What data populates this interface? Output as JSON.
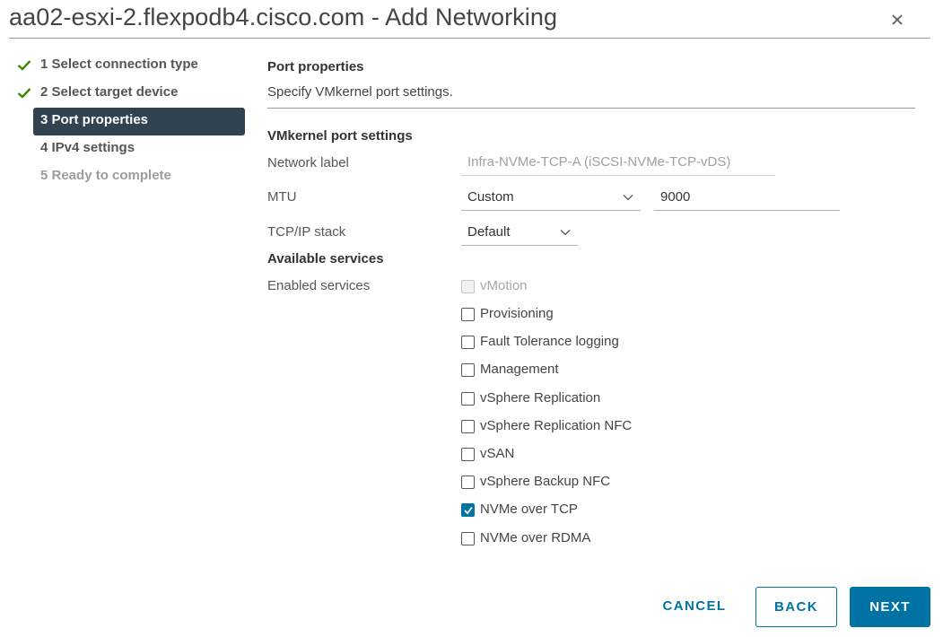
{
  "window": {
    "title": "aa02-esxi-2.flexpodb4.cisco.com - Add Networking"
  },
  "steps": [
    {
      "label": "1 Select connection type",
      "state": "completed"
    },
    {
      "label": "2 Select target device",
      "state": "completed"
    },
    {
      "label": "3 Port properties",
      "state": "active"
    },
    {
      "label": "4 IPv4 settings",
      "state": "pending"
    },
    {
      "label": "5 Ready to complete",
      "state": "disabled"
    }
  ],
  "page": {
    "heading": "Port properties",
    "subtitle": "Specify VMkernel port settings."
  },
  "vmkernel": {
    "section_title": "VMkernel port settings",
    "network_label": {
      "label": "Network label",
      "value": "Infra-NVMe-TCP-A (iSCSI-NVMe-TCP-vDS)"
    },
    "mtu": {
      "label": "MTU",
      "mode": "Custom",
      "value": "9000"
    },
    "tcpip": {
      "label": "TCP/IP stack",
      "value": "Default"
    }
  },
  "services": {
    "section_title": "Available services",
    "enabled_label": "Enabled services",
    "items": [
      {
        "label": "vMotion",
        "checked": false,
        "disabled": true
      },
      {
        "label": "Provisioning",
        "checked": false,
        "disabled": false
      },
      {
        "label": "Fault Tolerance logging",
        "checked": false,
        "disabled": false
      },
      {
        "label": "Management",
        "checked": false,
        "disabled": false
      },
      {
        "label": "vSphere Replication",
        "checked": false,
        "disabled": false
      },
      {
        "label": "vSphere Replication NFC",
        "checked": false,
        "disabled": false
      },
      {
        "label": "vSAN",
        "checked": false,
        "disabled": false
      },
      {
        "label": "vSphere Backup NFC",
        "checked": false,
        "disabled": false
      },
      {
        "label": "NVMe over TCP",
        "checked": true,
        "disabled": false
      },
      {
        "label": "NVMe over RDMA",
        "checked": false,
        "disabled": false
      }
    ]
  },
  "footer": {
    "cancel": "CANCEL",
    "back": "BACK",
    "next": "NEXT"
  },
  "colors": {
    "accent": "#0072a3",
    "active_step_bg": "#314351",
    "check_green": "#3c8500"
  },
  "icons": {
    "close": "close-icon",
    "step_done": "checkmark-icon",
    "dropdown": "chevron-down-icon"
  }
}
